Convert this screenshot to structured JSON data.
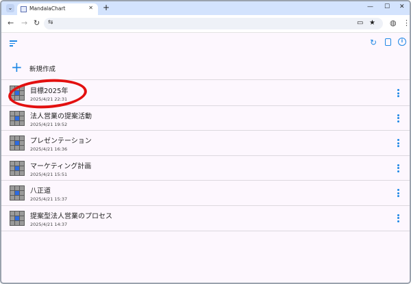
{
  "browser": {
    "tab_title": "MandalaChart",
    "new_tab_symbol": "+",
    "close_symbol": "✕",
    "minimize_symbol": "—",
    "maximize_symbol": "☐",
    "window_close_symbol": "✕",
    "address": ""
  },
  "toolbar": {
    "back_symbol": "←",
    "forward_symbol": "→",
    "reload_symbol": "↻"
  },
  "appbar": {
    "refresh_symbol": "↻",
    "info_symbol": "i"
  },
  "new_item": {
    "label": "新規作成",
    "plus_symbol": "+"
  },
  "charts": [
    {
      "title": "目標2025年",
      "date": "2025/4/21 22:31"
    },
    {
      "title": "法人営業の提案活動",
      "date": "2025/4/21 19:52"
    },
    {
      "title": "プレゼンテーション",
      "date": "2025/4/21 16:36"
    },
    {
      "title": "マーケティング計画",
      "date": "2025/4/21 15:51"
    },
    {
      "title": "八正道",
      "date": "2025/4/21 15:37"
    },
    {
      "title": "提案型法人営業のプロセス",
      "date": "2025/4/21 14:37"
    }
  ],
  "colors": {
    "accent": "#1e88e5",
    "highlight_ellipse": "#e31010",
    "thumbnail_center": "#2f6ce0",
    "thumbnail_cell": "#9a9a9a"
  },
  "icons": [
    "menu-icon",
    "refresh-icon",
    "download-icon",
    "info-icon",
    "more-vert-icon",
    "plus-icon"
  ]
}
